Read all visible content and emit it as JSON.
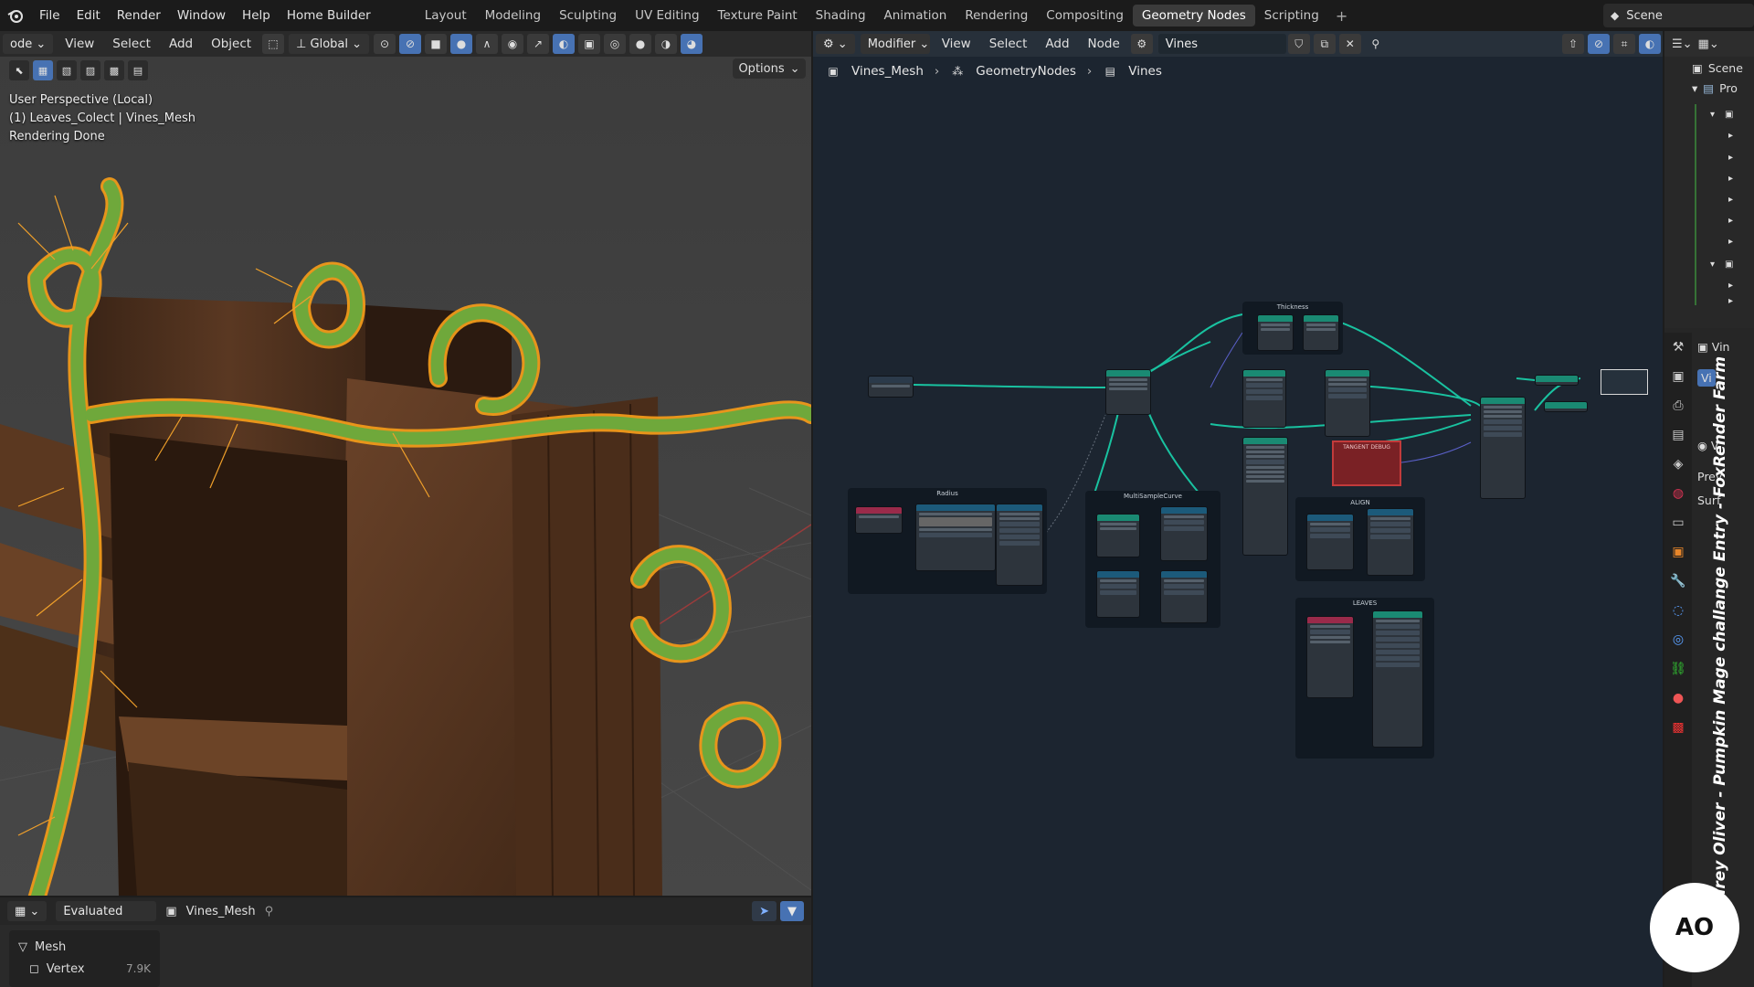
{
  "app": {
    "logo_icon": "blender-logo-icon",
    "menu": [
      "File",
      "Edit",
      "Render",
      "Window",
      "Help",
      "Home Builder"
    ],
    "workspaces": [
      "Layout",
      "Modeling",
      "Sculpting",
      "UV Editing",
      "Texture Paint",
      "Shading",
      "Animation",
      "Rendering",
      "Compositing",
      "Geometry Nodes",
      "Scripting"
    ],
    "active_workspace": "Geometry Nodes",
    "scene_label": "Scene"
  },
  "viewport": {
    "mode_label": "ode",
    "menu": [
      "View",
      "Select",
      "Add",
      "Object"
    ],
    "transform_orientation": "Global",
    "options_label": "Options",
    "overlay_lines": [
      "User Perspective (Local)",
      "(1) Leaves_Colect | Vines_Mesh",
      "Rendering Done"
    ]
  },
  "spreadsheet": {
    "eval_label": "Evaluated",
    "object_label": "Vines_Mesh",
    "domain_items": [
      {
        "label": "Mesh",
        "count": ""
      },
      {
        "label": "Vertex",
        "count": "7.9K"
      }
    ]
  },
  "node_editor": {
    "modifier_label": "Modifier",
    "menu": [
      "View",
      "Select",
      "Add",
      "Node"
    ],
    "tree_name": "Vines",
    "breadcrumbs": [
      "Vines_Mesh",
      "GeometryNodes",
      "Vines"
    ],
    "frames": [
      "Thickness",
      "Radius",
      "MultiSampleCurve",
      "ALIGN",
      "LEAVES"
    ],
    "tangent_label": "TANGENT DEBUG",
    "colors": {
      "link": "#19c2a0",
      "frame": "#111922",
      "tangent": "#c23b3b"
    }
  },
  "outliner": {
    "rows": [
      "Scene",
      "Pro"
    ]
  },
  "properties": {
    "rows": [
      "Vin",
      "Vi",
      "V",
      "Prev",
      "Surf"
    ]
  },
  "watermark": {
    "text": "Andrey Oliver - Pumpkin Mage challange Entry - FoxRender Farm",
    "logo": "AO"
  }
}
